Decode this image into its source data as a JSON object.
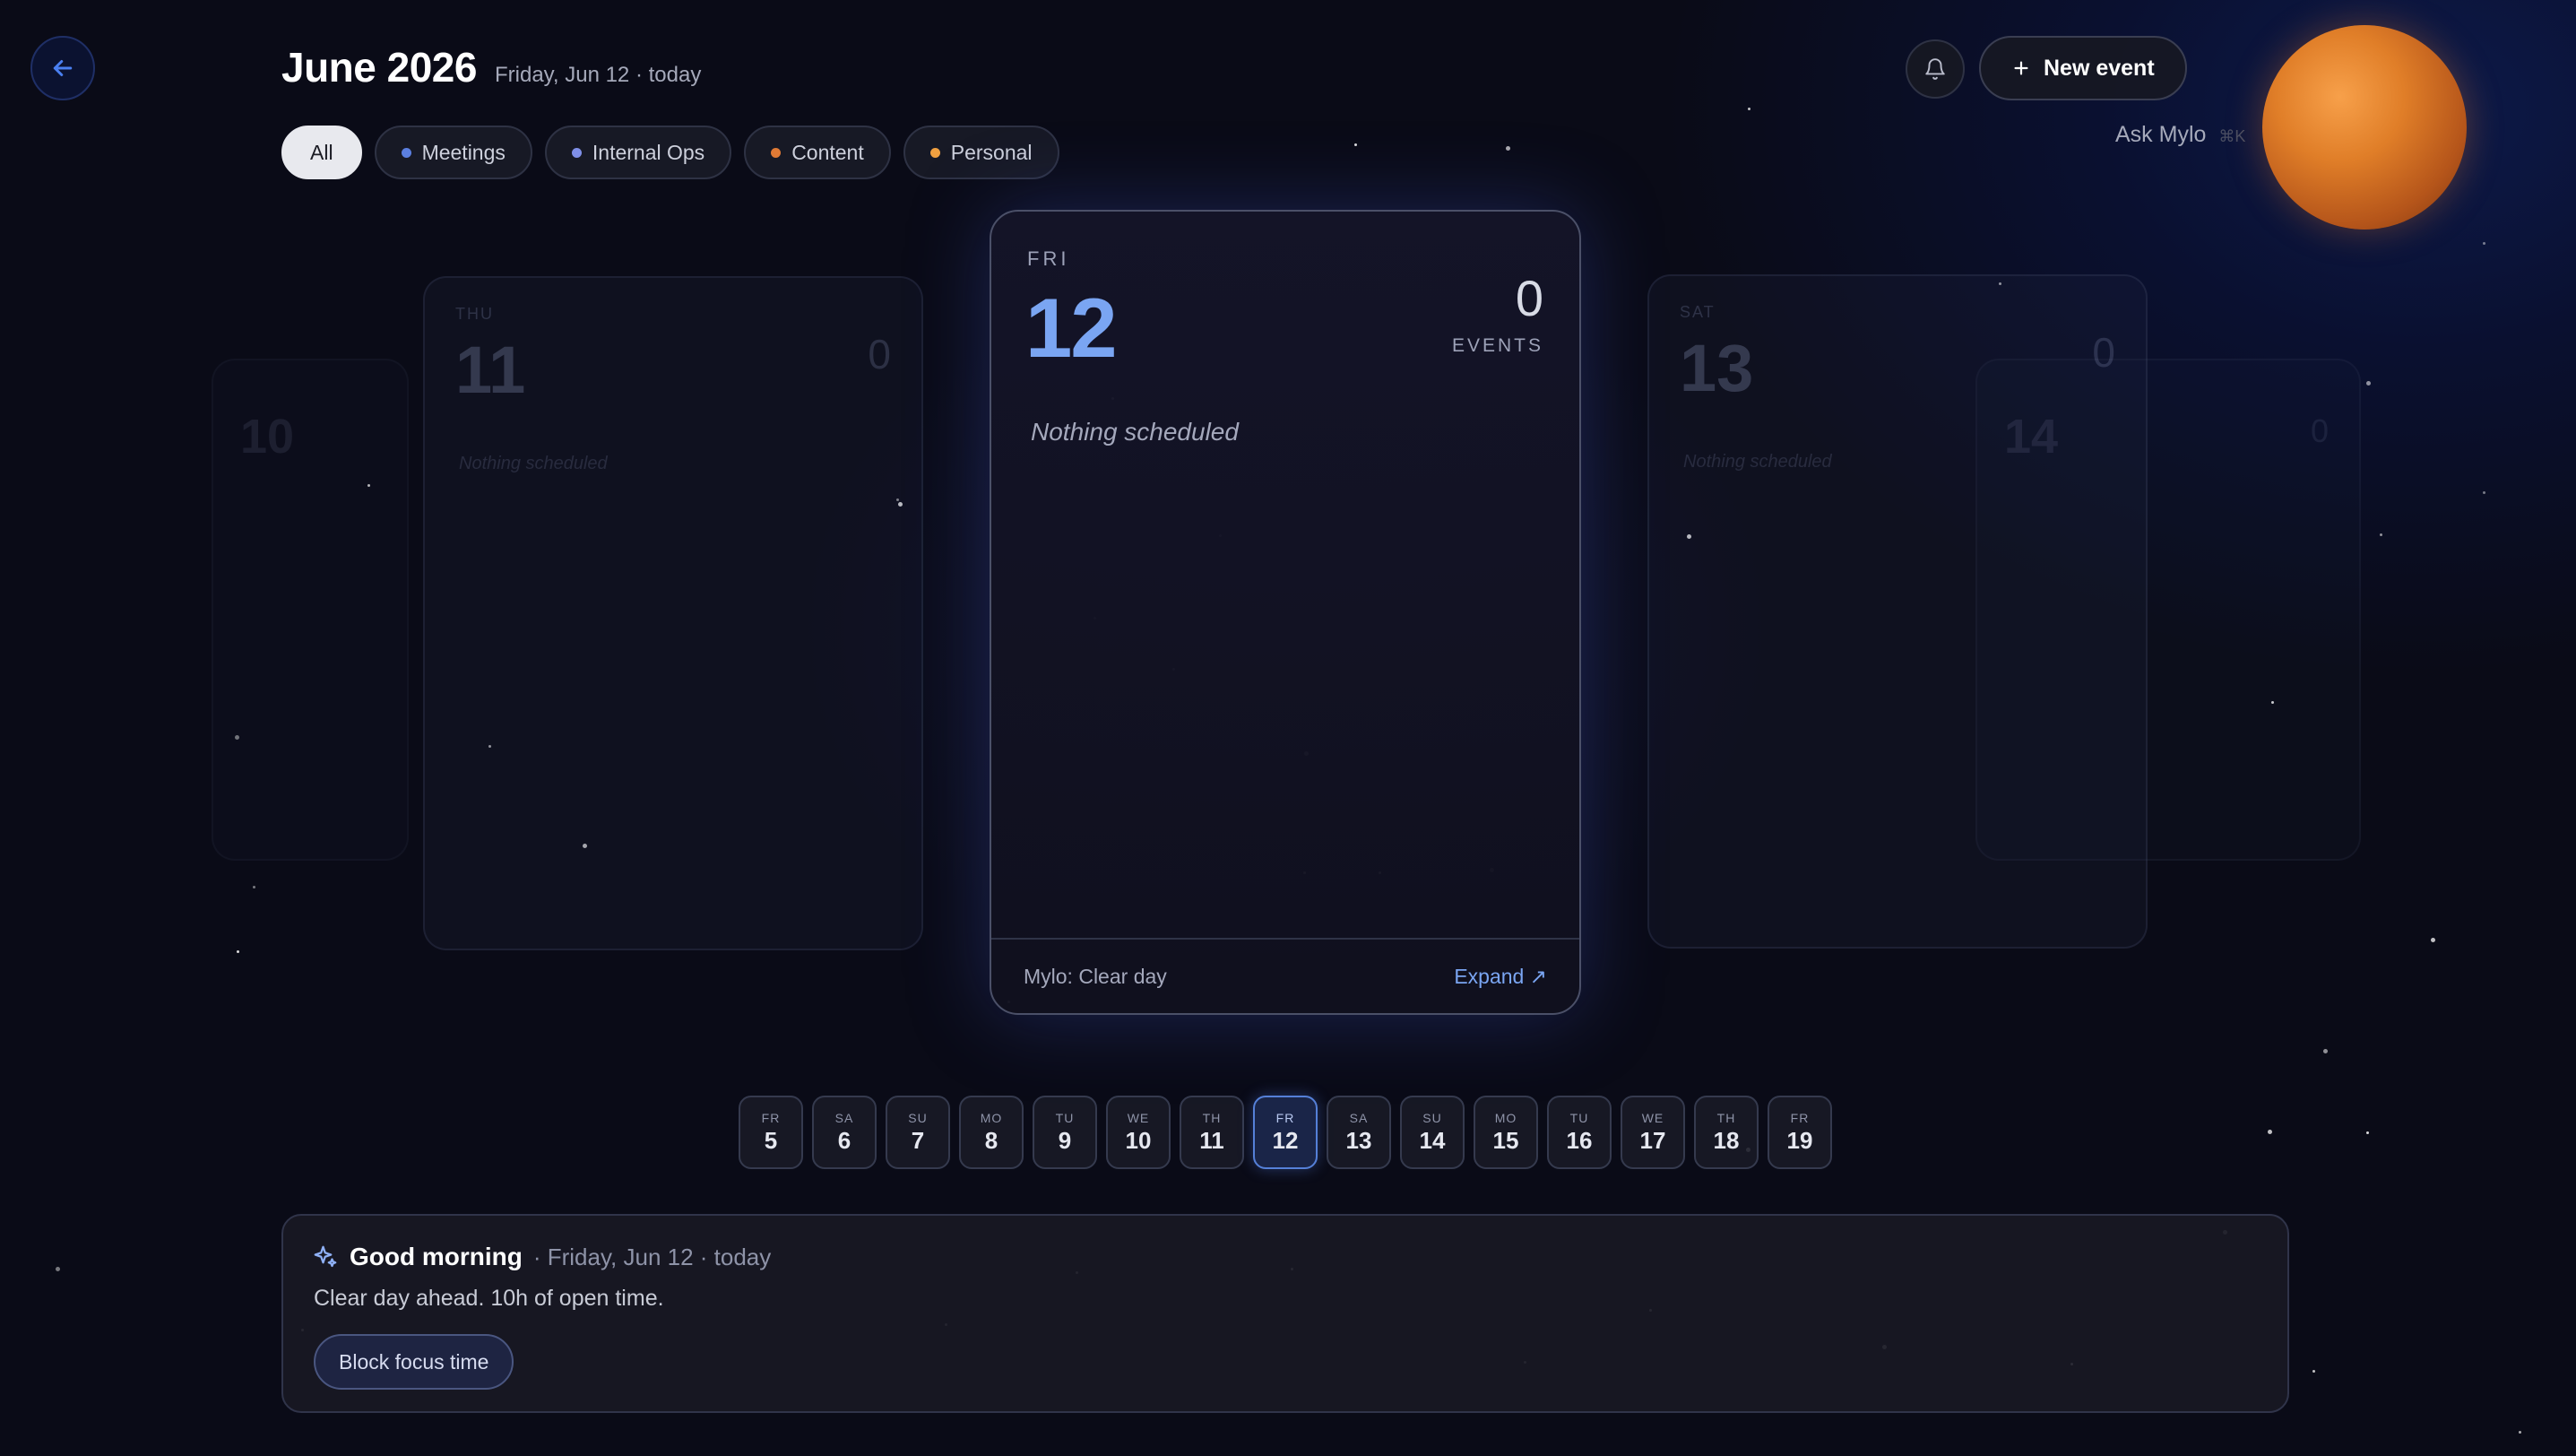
{
  "header": {
    "back_icon": "arrow-left-icon",
    "month_title": "June 2026",
    "date_subtitle": "Friday, Jun 12 · today",
    "bell_icon": "bell-icon",
    "new_event_label": "New event",
    "ask_label": "Ask Mylo",
    "ask_shortcut": "⌘K"
  },
  "filters": [
    {
      "label": "All",
      "active": true,
      "dot_color": ""
    },
    {
      "label": "Meetings",
      "active": false,
      "dot_color": "#5b7fe0"
    },
    {
      "label": "Internal Ops",
      "active": false,
      "dot_color": "#7f8fe8"
    },
    {
      "label": "Content",
      "active": false,
      "dot_color": "#e07a35"
    },
    {
      "label": "Personal",
      "active": false,
      "dot_color": "#f0a040"
    }
  ],
  "ghost_cards": {
    "left_far": {
      "number": "10"
    },
    "left": {
      "dow": "THU",
      "number": "11",
      "count": "0",
      "empty": "Nothing scheduled"
    },
    "right": {
      "dow": "SAT",
      "number": "13",
      "count": "0",
      "empty": "Nothing scheduled"
    },
    "right_far": {
      "number": "14",
      "count": "0"
    }
  },
  "day_card": {
    "dow": "FRI",
    "number": "12",
    "event_count": "0",
    "events_label": "EVENTS",
    "empty_text": "Nothing scheduled",
    "mylo_summary": "Mylo: Clear day",
    "expand_label": "Expand ↗"
  },
  "day_strip": [
    {
      "dow": "FR",
      "num": "5",
      "selected": false
    },
    {
      "dow": "SA",
      "num": "6",
      "selected": false
    },
    {
      "dow": "SU",
      "num": "7",
      "selected": false
    },
    {
      "dow": "MO",
      "num": "8",
      "selected": false
    },
    {
      "dow": "TU",
      "num": "9",
      "selected": false
    },
    {
      "dow": "WE",
      "num": "10",
      "selected": false
    },
    {
      "dow": "TH",
      "num": "11",
      "selected": false
    },
    {
      "dow": "FR",
      "num": "12",
      "selected": true
    },
    {
      "dow": "SA",
      "num": "13",
      "selected": false
    },
    {
      "dow": "SU",
      "num": "14",
      "selected": false
    },
    {
      "dow": "MO",
      "num": "15",
      "selected": false
    },
    {
      "dow": "TU",
      "num": "16",
      "selected": false
    },
    {
      "dow": "WE",
      "num": "17",
      "selected": false
    },
    {
      "dow": "TH",
      "num": "18",
      "selected": false
    },
    {
      "dow": "FR",
      "num": "19",
      "selected": false
    }
  ],
  "briefing": {
    "icon": "sparkles-icon",
    "greeting": "Good morning",
    "date": "· Friday, Jun 12 · today",
    "body": "Clear day ahead. 10h of open time.",
    "action_label": "Block focus time"
  },
  "colors": {
    "accent": "#7aa5f2",
    "planet": "#e07e28",
    "background": "#0a0a14"
  }
}
